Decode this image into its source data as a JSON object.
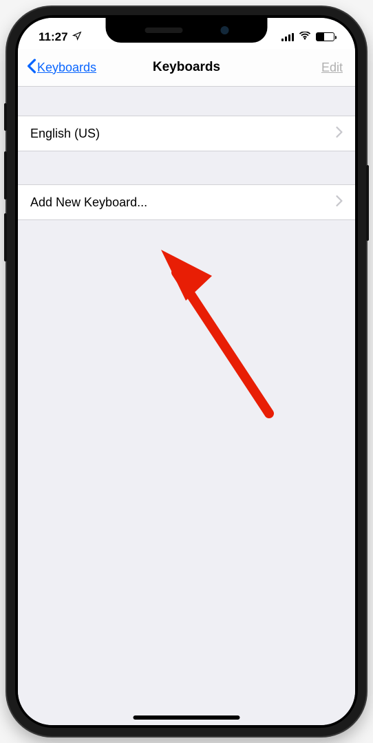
{
  "statusbar": {
    "time": "11:27"
  },
  "navbar": {
    "back_label": "Keyboards",
    "title": "Keyboards",
    "edit_label": "Edit"
  },
  "keyboards": {
    "items": [
      {
        "label": "English (US)"
      }
    ]
  },
  "add_row": {
    "label": "Add New Keyboard..."
  },
  "colors": {
    "ios_blue": "#0a66ff",
    "disabled_gray": "#b0b0b0",
    "annotation_red": "#e81e05"
  }
}
